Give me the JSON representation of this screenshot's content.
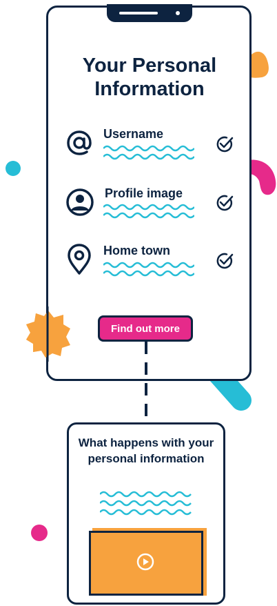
{
  "header": {
    "title": "Your Personal Information"
  },
  "items": [
    {
      "label": "Username",
      "icon": "at-sign-icon",
      "checked": true
    },
    {
      "label": "Profile image",
      "icon": "user-avatar-icon",
      "checked": true
    },
    {
      "label": "Home town",
      "icon": "location-pin-icon",
      "checked": true
    }
  ],
  "cta": {
    "label": "Find out more"
  },
  "info_card": {
    "text": "What happens with your personal information",
    "media": "video-play-icon"
  },
  "colors": {
    "navy": "#0d2340",
    "pink": "#e62a8a",
    "orange": "#f7a23e",
    "cyan": "#26bdd6"
  }
}
